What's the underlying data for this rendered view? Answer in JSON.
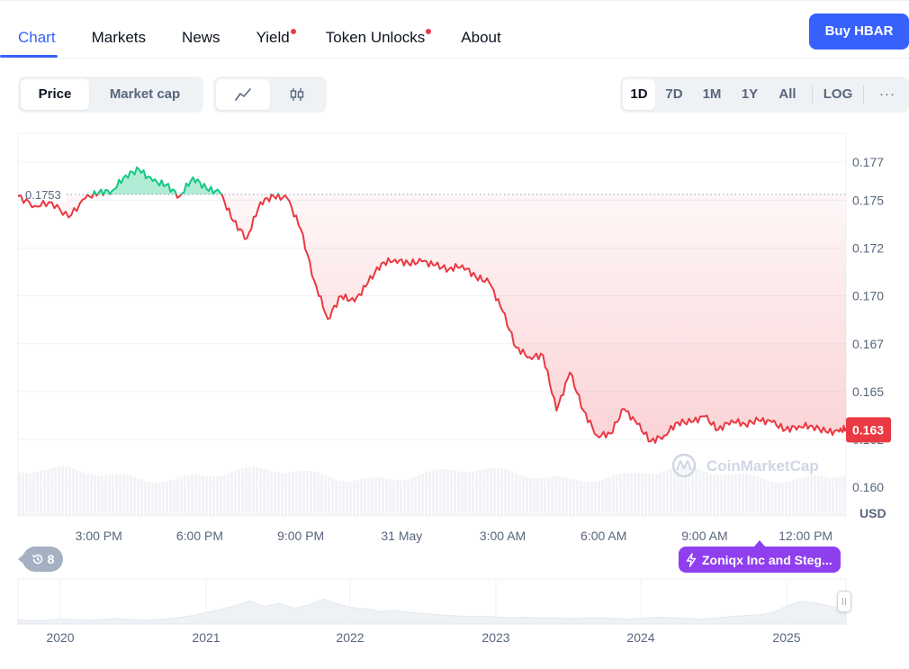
{
  "tabs": [
    {
      "label": "Chart",
      "active": true,
      "dot": false
    },
    {
      "label": "Markets",
      "active": false,
      "dot": false
    },
    {
      "label": "News",
      "active": false,
      "dot": false
    },
    {
      "label": "Yield",
      "active": false,
      "dot": true
    },
    {
      "label": "Token Unlocks",
      "active": false,
      "dot": true
    },
    {
      "label": "About",
      "active": false,
      "dot": false
    }
  ],
  "buy_button": "Buy HBAR",
  "chart_type_toggle": {
    "price": "Price",
    "market_cap": "Market cap",
    "selected": "Price"
  },
  "view_toggle": {
    "line_icon": "line-chart-icon",
    "candle_icon": "candlestick-icon",
    "selected": "line"
  },
  "ranges": {
    "items": [
      "1D",
      "7D",
      "1M",
      "1Y",
      "All"
    ],
    "selected": "1D",
    "log": "LOG",
    "more": "···"
  },
  "colors": {
    "up": "#16c784",
    "down": "#ea3943",
    "accent": "#3861fb",
    "news": "#8f3fee"
  },
  "chart_data": {
    "type": "line",
    "reference_price": 0.1753,
    "reference_label": "0.1753",
    "current_price": 0.163,
    "current_label": "0.163",
    "currency": "USD",
    "ylim": [
      0.1585,
      0.1785
    ],
    "y_ticks": [
      "0.177",
      "0.175",
      "0.172",
      "0.170",
      "0.167",
      "0.165",
      "0.162",
      "0.160"
    ],
    "y_tick_values": [
      0.177,
      0.175,
      0.1725,
      0.17,
      0.1675,
      0.165,
      0.1625,
      0.16
    ],
    "x_ticks": [
      "3:00 PM",
      "6:00 PM",
      "9:00 PM",
      "31 May",
      "3:00 AM",
      "6:00 AM",
      "9:00 AM",
      "12:00 PM"
    ],
    "x_tick_hours": [
      3,
      6,
      9,
      12,
      15,
      18,
      21,
      24
    ],
    "x_range_hours": [
      0.6,
      25.2
    ],
    "series": [
      {
        "x": [
          0.6,
          1.1,
          1.6,
          2.1,
          2.6,
          3.0,
          3.4,
          3.8,
          4.2,
          4.6,
          5.0,
          5.4,
          5.8,
          6.2,
          6.6,
          7.0,
          7.4,
          7.8,
          8.2,
          8.6,
          9.0,
          9.4,
          9.8,
          10.2,
          10.6,
          11.0,
          11.4,
          11.8,
          12.2,
          12.6,
          13.0,
          13.4,
          13.8,
          14.2,
          14.6,
          15.0,
          15.4,
          15.8,
          16.2,
          16.6,
          17.0,
          17.4,
          17.8,
          18.2,
          18.6,
          19.0,
          19.4,
          19.8,
          20.2,
          20.6,
          21.0,
          21.4,
          21.8,
          22.2,
          22.6,
          23.0,
          23.4,
          23.8,
          24.2,
          24.6,
          25.0,
          25.2
        ],
        "y": [
          0.1752,
          0.1747,
          0.1749,
          0.1741,
          0.1751,
          0.1754,
          0.1755,
          0.1763,
          0.1766,
          0.176,
          0.1758,
          0.1752,
          0.1762,
          0.1756,
          0.1754,
          0.1739,
          0.173,
          0.1749,
          0.1752,
          0.1751,
          0.1735,
          0.1708,
          0.1688,
          0.17,
          0.1697,
          0.1707,
          0.1717,
          0.1719,
          0.1717,
          0.1718,
          0.1716,
          0.1714,
          0.1716,
          0.171,
          0.1707,
          0.1692,
          0.1673,
          0.1668,
          0.1669,
          0.164,
          0.166,
          0.164,
          0.1627,
          0.1628,
          0.1641,
          0.1633,
          0.1624,
          0.1627,
          0.1634,
          0.1634,
          0.1637,
          0.163,
          0.1635,
          0.1633,
          0.1635,
          0.1634,
          0.163,
          0.1632,
          0.1632,
          0.1629,
          0.1629,
          0.1631
        ]
      }
    ],
    "watermark": "CoinMarketCap",
    "navigator_ticks": [
      "2020",
      "2021",
      "2022",
      "2023",
      "2024",
      "2025"
    ],
    "navigator_values": [
      0.1,
      0.08,
      0.09,
      0.12,
      0.1,
      0.09,
      0.11,
      0.13,
      0.1,
      0.09,
      0.12,
      0.15,
      0.2,
      0.28,
      0.35,
      0.45,
      0.55,
      0.42,
      0.5,
      0.38,
      0.45,
      0.6,
      0.48,
      0.4,
      0.36,
      0.3,
      0.33,
      0.28,
      0.25,
      0.22,
      0.2,
      0.18,
      0.19,
      0.17,
      0.15,
      0.16,
      0.14,
      0.15,
      0.13,
      0.14,
      0.15,
      0.13,
      0.12,
      0.14,
      0.16,
      0.15,
      0.13,
      0.12,
      0.14,
      0.18,
      0.2,
      0.22,
      0.28,
      0.45,
      0.55,
      0.5,
      0.42,
      0.38
    ]
  },
  "events_badge": {
    "count": "8",
    "icon": "history-icon"
  },
  "news_pill": {
    "text": "Zoniqx Inc and Steg...",
    "icon": "lightning-icon"
  }
}
